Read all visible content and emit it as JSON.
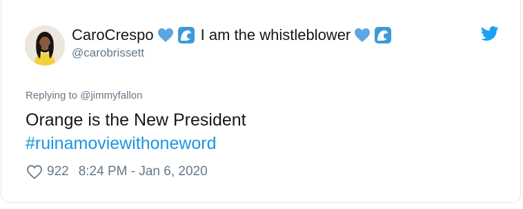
{
  "tweet": {
    "author": {
      "display_name": "CaroCrespo",
      "name_suffix": "I am the whistleblower",
      "handle": "@carobrissett",
      "avatar_icon": "profile-photo"
    },
    "platform_icon": "twitter-bird-icon",
    "reply_prefix": "Replying to",
    "reply_to": "@jimmyfallon",
    "text": "Orange is the New President",
    "hashtag": "#ruinamoviewithoneword",
    "likes": "922",
    "timestamp": "8:24 PM - Jan 6, 2020",
    "colors": {
      "text": "#14171a",
      "secondary": "#657786",
      "link": "#1b95e0",
      "twitter_blue": "#1da1f2",
      "heart_emoji": "#5da6e6",
      "wave_emoji": "#3b9ad9"
    }
  }
}
